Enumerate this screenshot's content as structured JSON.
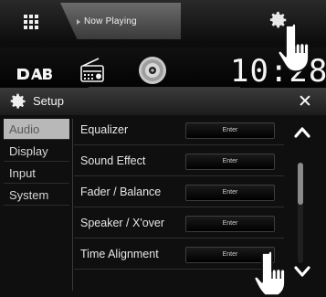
{
  "home": {
    "now_playing_label": "Now Playing",
    "source_icons": [
      "dab-icon",
      "radio-icon",
      "disc-icon"
    ],
    "clock": "10:28"
  },
  "setup": {
    "title": "Setup",
    "close_label": "✕",
    "sidebar": {
      "items": [
        {
          "label": "Audio",
          "active": true
        },
        {
          "label": "Display",
          "active": false
        },
        {
          "label": "Input",
          "active": false
        },
        {
          "label": "System",
          "active": false
        }
      ]
    },
    "menu": {
      "rows": [
        {
          "label": "Equalizer",
          "button": "Enter"
        },
        {
          "label": "Sound Effect",
          "button": "Enter"
        },
        {
          "label": "Fader / Balance",
          "button": "Enter"
        },
        {
          "label": "Speaker / X'over",
          "button": "Enter"
        },
        {
          "label": "Time Alignment",
          "button": "Enter"
        }
      ]
    }
  },
  "colors": {
    "background": "#0f0f0f",
    "active_tab": "#b8b8b8",
    "text": "#e6e6e6"
  }
}
